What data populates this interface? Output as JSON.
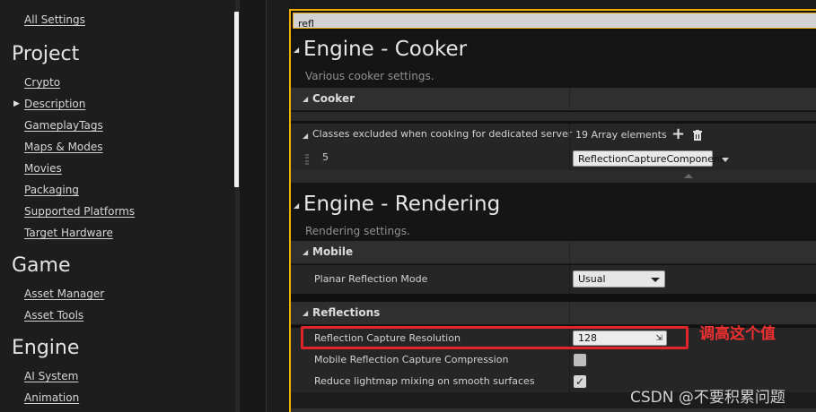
{
  "sidebar": {
    "all_settings": "All Settings",
    "project_title": "Project",
    "project_items": [
      "Crypto",
      "Description",
      "GameplayTags",
      "Maps & Modes",
      "Movies",
      "Packaging",
      "Supported Platforms",
      "Target Hardware"
    ],
    "game_title": "Game",
    "game_items": [
      "Asset Manager",
      "Asset Tools"
    ],
    "engine_title": "Engine",
    "engine_items": [
      "AI System",
      "Animation"
    ]
  },
  "search": {
    "value": "refl"
  },
  "cooker": {
    "title": "Engine - Cooker",
    "description": "Various cooker settings.",
    "section": "Cooker",
    "classes_label": "Classes excluded when cooking for dedicated server",
    "array_count": "19 Array elements",
    "element_index": "5",
    "element_value": "ReflectionCaptureComponent"
  },
  "rendering": {
    "title": "Engine - Rendering",
    "description": "Rendering settings.",
    "mobile_section": "Mobile",
    "planar_label": "Planar Reflection Mode",
    "planar_value": "Usual",
    "reflections_section": "Reflections",
    "capture_res_label": "Reflection Capture Resolution",
    "capture_res_value": "128",
    "mobile_compression_label": "Mobile Reflection Capture Compression",
    "mobile_compression_checked": false,
    "reduce_lightmap_label": "Reduce lightmap mixing on smooth surfaces",
    "reduce_lightmap_checked": true
  },
  "annotation": "调高这个值",
  "watermark": "CSDN @不要积累问题",
  "colors": {
    "accent": "#f0b000",
    "highlight": "#e0262a"
  }
}
